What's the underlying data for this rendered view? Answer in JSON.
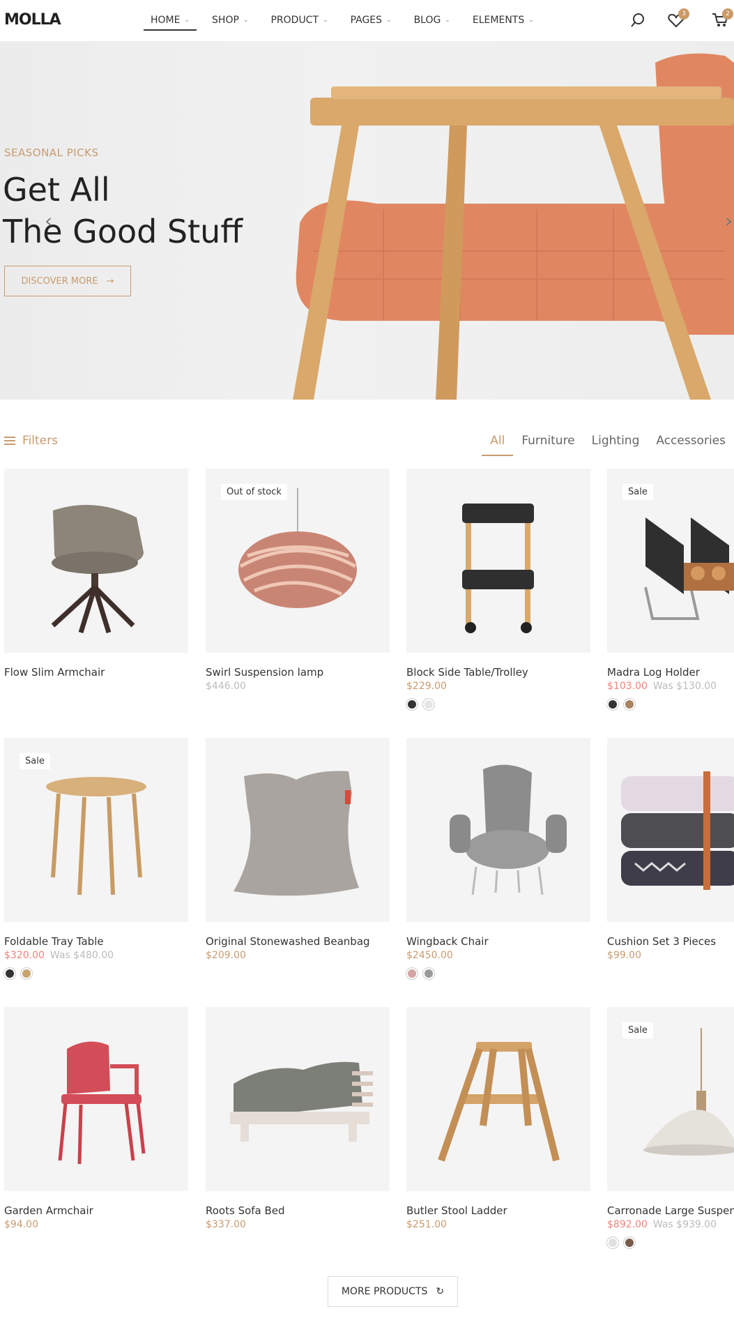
{
  "header": {
    "logo": "MOLLA",
    "nav": [
      {
        "label": "HOME",
        "active": true
      },
      {
        "label": "SHOP"
      },
      {
        "label": "PRODUCT"
      },
      {
        "label": "PAGES"
      },
      {
        "label": "BLOG"
      },
      {
        "label": "ELEMENTS"
      }
    ],
    "wishlist_count": "3",
    "cart_count": "2"
  },
  "hero": {
    "kicker": "SEASONAL PICKS",
    "title_line1": "Get All",
    "title_line2": "The Good Stuff",
    "button": "DISCOVER MORE"
  },
  "filters": {
    "label": "Filters",
    "tabs": [
      "All",
      "Furniture",
      "Lighting",
      "Accessories"
    ]
  },
  "products": [
    {
      "name": "Flow Slim Armchair",
      "price": "",
      "label": "",
      "swatches": []
    },
    {
      "name": "Swirl Suspension lamp",
      "price": "$446.00",
      "label": "Out of stock",
      "swatches": []
    },
    {
      "name": "Block Side Table/Trolley",
      "price": "$229.00",
      "label": "",
      "swatches": [
        "#333333",
        "#e5e5e5"
      ]
    },
    {
      "name": "Madra Log Holder",
      "price": "$103.00",
      "was": "Was $130.00",
      "label": "Sale",
      "swatches": [
        "#333333",
        "#a88460"
      ]
    },
    {
      "name": "Foldable Tray Table",
      "price": "$320.00",
      "was": "Was $480.00",
      "label": "Sale",
      "swatches": [
        "#333333",
        "#c8a46e"
      ]
    },
    {
      "name": "Original Stonewashed Beanbag",
      "price": "$209.00",
      "label": "",
      "swatches": []
    },
    {
      "name": "Wingback Chair",
      "price": "$2450.00",
      "label": "",
      "swatches": [
        "#d4a3a3",
        "#999999"
      ]
    },
    {
      "name": "Cushion Set 3 Pieces",
      "price": "$99.00",
      "label": "",
      "swatches": []
    },
    {
      "name": "Garden Armchair",
      "price": "$94.00",
      "label": "",
      "swatches": []
    },
    {
      "name": "Roots Sofa Bed",
      "price": "$337.00",
      "label": "",
      "swatches": []
    },
    {
      "name": "Butler Stool Ladder",
      "price": "$251.00",
      "label": "",
      "swatches": []
    },
    {
      "name": "Carronade Large Suspen Lamp",
      "price": "$892.00",
      "was": "Was $939.00",
      "label": "Sale",
      "swatches": [
        "#e0e0e0",
        "#7a5a48"
      ]
    }
  ],
  "more_button": "MORE PRODUCTS",
  "colors": {
    "accent": "#c99b6e",
    "sale": "#ef837b"
  }
}
